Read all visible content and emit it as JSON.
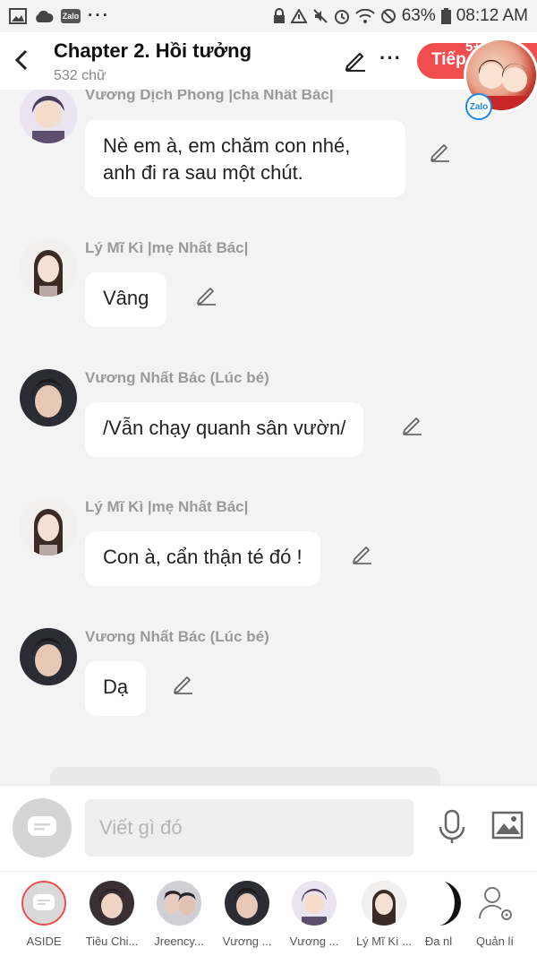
{
  "status_bar": {
    "battery": "63%",
    "time": "08:12 AM"
  },
  "header": {
    "title": "Chapter 2. Hồi tưởng",
    "word_count": "532 chữ",
    "next_label": "Tiếp",
    "next_badge": "5+",
    "zalo_label": "Zalo"
  },
  "messages": [
    {
      "sender": "Vương Dịch Phong |cha Nhất Bác|",
      "text": "Nè em à, em chăm con nhé, anh đi ra sau một chút."
    },
    {
      "sender": "Lý Mĩ Kì |mẹ Nhất Bác|",
      "text": "Vâng"
    },
    {
      "sender": "Vương Nhất Bác (Lúc bé)",
      "text": "/Vẫn chạy quanh sân vườn/"
    },
    {
      "sender": "Lý Mĩ Kì |mẹ Nhất Bác|",
      "text": "Con à, cẩn thận té đó !"
    },
    {
      "sender": "Vương Nhất Bác (Lúc bé)",
      "text": "Dạ"
    }
  ],
  "composer": {
    "placeholder": "Viết gì đó"
  },
  "characters": [
    {
      "label": "ASIDE"
    },
    {
      "label": "Tiêu Chi..."
    },
    {
      "label": "Jreency..."
    },
    {
      "label": "Vương ..."
    },
    {
      "label": "Vương ..."
    },
    {
      "label": "Lý Mĩ Kì ..."
    },
    {
      "label": "Đa nl"
    },
    {
      "label": "Quản lí"
    }
  ],
  "colors": {
    "accent": "#f04e4e",
    "background": "#f3f3f3",
    "bubble": "#ffffff",
    "sender": "#9a9a9a"
  }
}
